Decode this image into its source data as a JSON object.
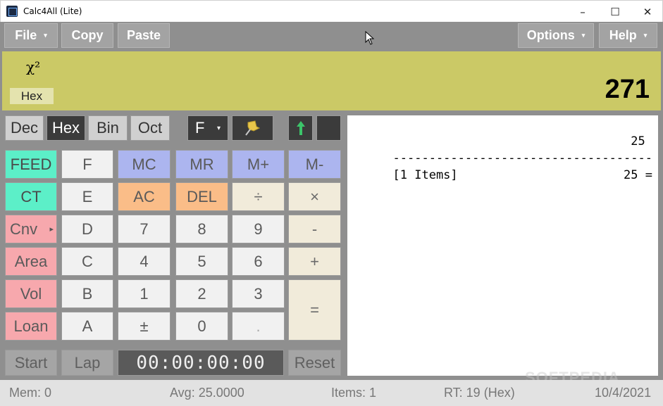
{
  "window": {
    "title": "Calc4All (Lite)",
    "minimize": "–",
    "maximize": "☐",
    "close": "✕"
  },
  "menu": {
    "file": "File",
    "copy": "Copy",
    "paste": "Paste",
    "options": "Options",
    "help": "Help",
    "caret": "▾"
  },
  "display": {
    "symbol": "χ²",
    "mode": "Hex",
    "value": "271"
  },
  "base_modes": {
    "dec": "Dec",
    "hex": "Hex",
    "bin": "Bin",
    "oct": "Oct",
    "selected": "Hex"
  },
  "format_select": {
    "value": "F",
    "caret": "▾"
  },
  "toolbar_icons": {
    "pin": "pin-icon",
    "up_arrow": "up-arrow-icon"
  },
  "keys": {
    "feed": "FEED",
    "ct": "CT",
    "cnv": "Cnv",
    "cnv_arrow": "▸",
    "area": "Area",
    "vol": "Vol",
    "loan": "Loan",
    "hex_f": "F",
    "hex_e": "E",
    "hex_d": "D",
    "hex_c": "C",
    "hex_b": "B",
    "hex_a": "A",
    "mc": "MC",
    "mr": "MR",
    "mplus": "M+",
    "mminus": "M-",
    "ac": "AC",
    "del": "DEL",
    "divide": "÷",
    "multiply": "×",
    "d7": "7",
    "d8": "8",
    "d9": "9",
    "minus": "-",
    "d4": "4",
    "d5": "5",
    "d6": "6",
    "plus": "+",
    "d1": "1",
    "d2": "2",
    "d3": "3",
    "equals": "=",
    "plusminus": "±",
    "d0": "0",
    "dot": "."
  },
  "stopwatch": {
    "start": "Start",
    "lap": "Lap",
    "time": "00:00:00:00",
    "reset": "Reset"
  },
  "tape": {
    "lines": [
      "25 ",
      "------------------------------------",
      "[1 Items]                       25 ="
    ]
  },
  "status": {
    "mem": "Mem: 0",
    "avg": "Avg: 25.0000",
    "items": "Items: 1",
    "rt": "RT: 19 (Hex)",
    "date": "10/4/2021"
  },
  "watermark": "SOFTPEDIA",
  "colors": {
    "display_bg": "#cbc966",
    "teal": "#5cefc8",
    "pink": "#f7a8ad",
    "blue": "#acb5ef",
    "orange": "#fabd88",
    "cream": "#f1ebda",
    "selected_mode": "#3b3b3b"
  }
}
